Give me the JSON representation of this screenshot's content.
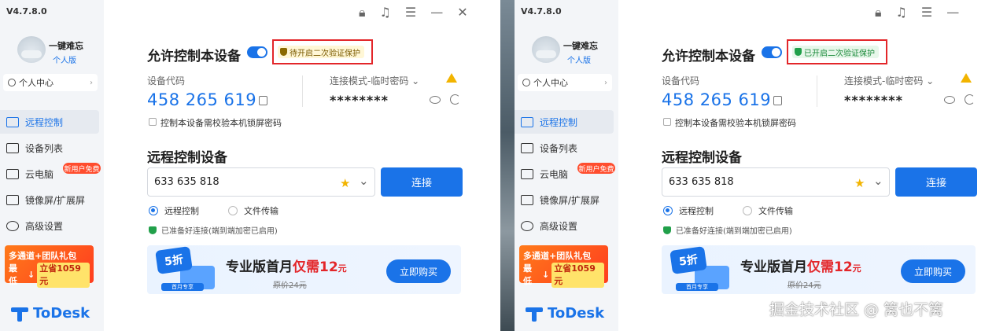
{
  "app": {
    "version": "V4.7.8.0",
    "logo_text": "ToDesk"
  },
  "user": {
    "name": "一键难忘",
    "tier": "个人版",
    "center_label": "个人中心"
  },
  "nav": [
    {
      "label": "远程控制",
      "icon": "monitor-icon"
    },
    {
      "label": "设备列表",
      "icon": "devices-icon"
    },
    {
      "label": "云电脑",
      "icon": "cloud-pc-icon",
      "badge": "新用户免费"
    },
    {
      "label": "镜像屏/扩展屏",
      "icon": "mirror-icon"
    },
    {
      "label": "高级设置",
      "icon": "gear-icon"
    }
  ],
  "side_promo": {
    "line1": "多通道+团队礼包",
    "prefix": "最低",
    "tag": "立省1059元"
  },
  "main": {
    "allow_title": "允许控制本设备",
    "device_code_label": "设备代码",
    "device_code": "458 265 619",
    "mode_label": "连接模式-临时密码",
    "password": "********",
    "lock_check_label": "控制本设备需校验本机锁屏密码",
    "remote_title": "远程控制设备",
    "remote_id": "633 635 818",
    "connect_label": "连接",
    "radio_remote": "远程控制",
    "radio_file": "文件传输",
    "ready_text": "已准备好连接(端到端加密已启用)"
  },
  "banner": {
    "disc": "5折",
    "strip": "首月专享",
    "title": "专业版首月",
    "price_prefix": "仅需12",
    "price_unit": "元",
    "original": "原价24元",
    "buy_label": "立即购买"
  },
  "security": {
    "pending": "待开启二次验证保护",
    "enabled": "已开启二次验证保护"
  },
  "watermark": "掘金技术社区 @ 篱也不篱",
  "colors": {
    "accent": "#1a73e8",
    "highlight": "#e3262a",
    "warning": "#f2b400",
    "success": "#21a04a"
  }
}
